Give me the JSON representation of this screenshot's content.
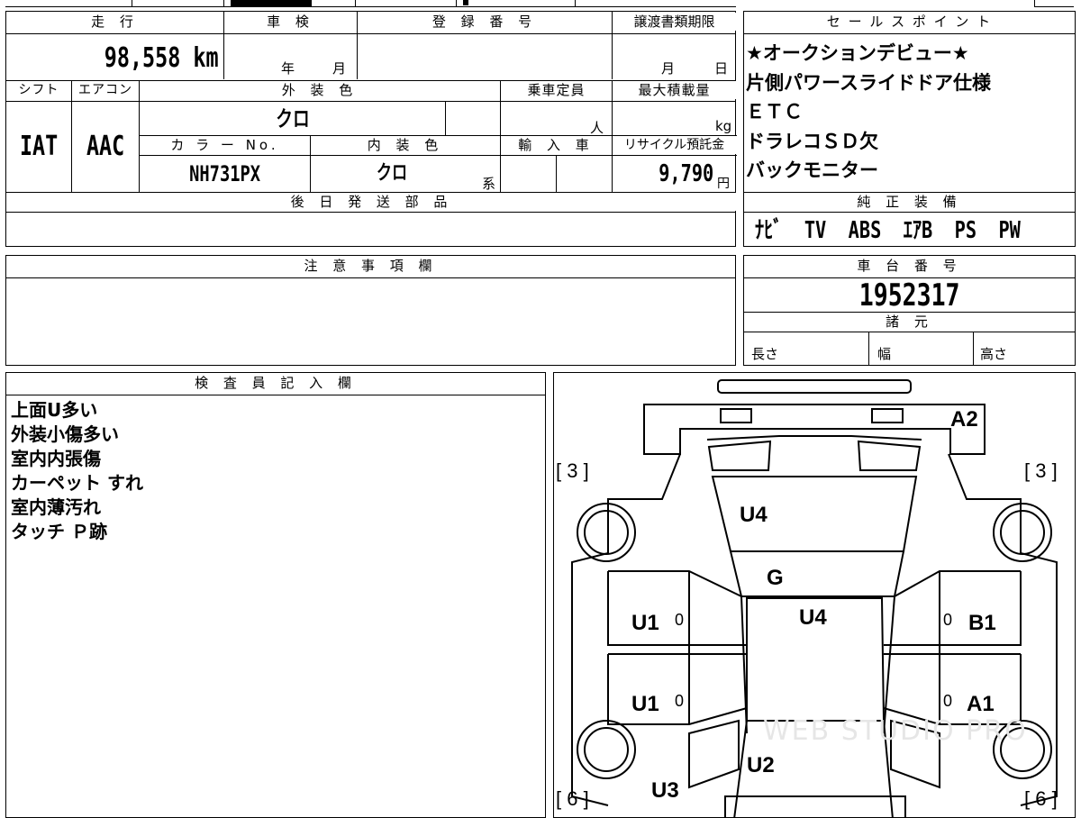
{
  "vehicle": {
    "mileage_label": "走 行",
    "mileage": "98,558 km",
    "inspection_label": "車 検",
    "inspection_year_unit": "年",
    "inspection_month_unit": "月",
    "registration_label": "登 録 番 号",
    "transfer_label": "譲渡書類期限",
    "transfer_month_unit": "月",
    "transfer_day_unit": "日",
    "shift_label": "シフト",
    "shift": "IAT",
    "ac_label": "エアコン",
    "ac": "AAC",
    "exterior_color_label": "外 装 色",
    "exterior_color": "クロ",
    "color_no_label": "カ ラ ー No.",
    "color_no": "NH731PX",
    "interior_color_label": "内 装 色",
    "interior_color": "クロ",
    "interior_suffix": "系",
    "capacity_label": "乗車定員",
    "capacity_unit": "人",
    "max_load_label": "最大積載量",
    "max_load_unit": "kg",
    "import_label": "輸 入 車",
    "recycle_label": "リサイクル預託金",
    "recycle_fee": "9,790",
    "recycle_unit": "円",
    "later_parts_label": "後 日 発 送 部 品"
  },
  "sales_points": {
    "label": "セ ー ル ス ポ イ ン ト",
    "items": [
      "★オークションデビュー★",
      "片側パワースライドドア仕様",
      "ＥＴＣ",
      "ドラレコＳＤ欠",
      "バックモニター"
    ]
  },
  "equipment": {
    "label": "純 正 装 備",
    "items": "ﾅﾋﾞ  TV  ABS  ｴｱB  PS  PW"
  },
  "notes": {
    "label": "注 意 事 項 欄"
  },
  "chassis": {
    "label": "車 台 番 号",
    "number": "1952317",
    "specs_label": "諸 元",
    "length_label": "長さ",
    "width_label": "幅",
    "height_label": "高さ"
  },
  "inspector": {
    "label": "検 査 員 記 入 欄",
    "items": [
      "上面U多い",
      "外装小傷多い",
      "室内内張傷",
      "カーペット すれ",
      "室内薄汚れ",
      "タッチ Ｐ跡"
    ]
  },
  "diagram": {
    "left_front_tire_code": "[ 3 ]",
    "right_front_tire_code": "[ 3 ]",
    "left_rear_tire_code": "[ 6 ]",
    "right_rear_tire_code": "[ 6 ]",
    "d_a2": "A2",
    "d_u4_hood": "U4",
    "d_g": "G",
    "d_u4_roof": "U4",
    "d_u1_front": "U1",
    "d_u1_rear": "U1",
    "d_b1": "B1",
    "d_a1": "A1",
    "d_u2": "U2",
    "d_u3": "U3",
    "zero_1": "0",
    "zero_2": "0",
    "zero_3": "0",
    "zero_4": "0",
    "watermark": "WEB STUDIO PRO"
  }
}
